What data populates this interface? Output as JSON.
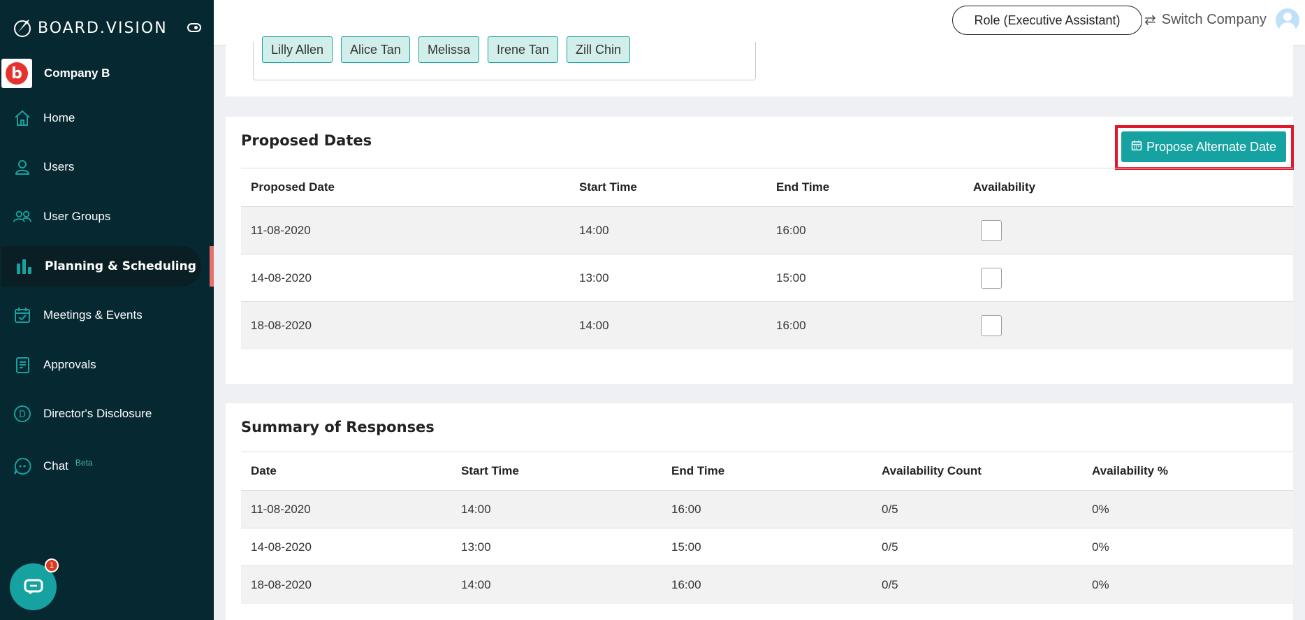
{
  "brand": {
    "name": "BOARD.VISION"
  },
  "company": {
    "name": "Company B",
    "logo_letter": "b"
  },
  "sidebar": {
    "items": [
      {
        "label": "Home",
        "icon": "home-icon"
      },
      {
        "label": "Users",
        "icon": "user-icon"
      },
      {
        "label": "User Groups",
        "icon": "users-icon"
      },
      {
        "label": "Planning & Scheduling",
        "icon": "bar-chart-icon",
        "active": true
      },
      {
        "label": "Meetings & Events",
        "icon": "calendar-check-icon"
      },
      {
        "label": "Approvals",
        "icon": "document-icon"
      },
      {
        "label": "Director's Disclosure",
        "icon": "d-circle-icon"
      },
      {
        "label": "Chat",
        "icon": "chat-icon",
        "badge": "Beta"
      }
    ]
  },
  "chat_widget": {
    "badge_count": "1"
  },
  "topbar": {
    "role": "Role (Executive Assistant)",
    "switch_company": "Switch Company"
  },
  "attendees": [
    "Lilly Allen",
    "Alice Tan",
    "Melissa",
    "Irene Tan",
    "Zill Chin"
  ],
  "proposed_dates": {
    "title": "Proposed Dates",
    "button": "Propose Alternate Date",
    "columns": [
      "Proposed Date",
      "Start Time",
      "End Time",
      "Availability"
    ],
    "rows": [
      {
        "date": "11-08-2020",
        "start": "14:00",
        "end": "16:00",
        "available": false
      },
      {
        "date": "14-08-2020",
        "start": "13:00",
        "end": "15:00",
        "available": false
      },
      {
        "date": "18-08-2020",
        "start": "14:00",
        "end": "16:00",
        "available": false
      }
    ]
  },
  "summary": {
    "title": "Summary of Responses",
    "columns": [
      "Date",
      "Start Time",
      "End Time",
      "Availability Count",
      "Availability %"
    ],
    "rows": [
      {
        "date": "11-08-2020",
        "start": "14:00",
        "end": "16:00",
        "count": "0/5",
        "percent": "0%"
      },
      {
        "date": "14-08-2020",
        "start": "13:00",
        "end": "15:00",
        "count": "0/5",
        "percent": "0%"
      },
      {
        "date": "18-08-2020",
        "start": "14:00",
        "end": "16:00",
        "count": "0/5",
        "percent": "0%"
      }
    ]
  },
  "colors": {
    "sidebar": "#062831",
    "accent": "#17a2a2",
    "highlight": "#e0182c",
    "active_marker": "#e8706d"
  }
}
